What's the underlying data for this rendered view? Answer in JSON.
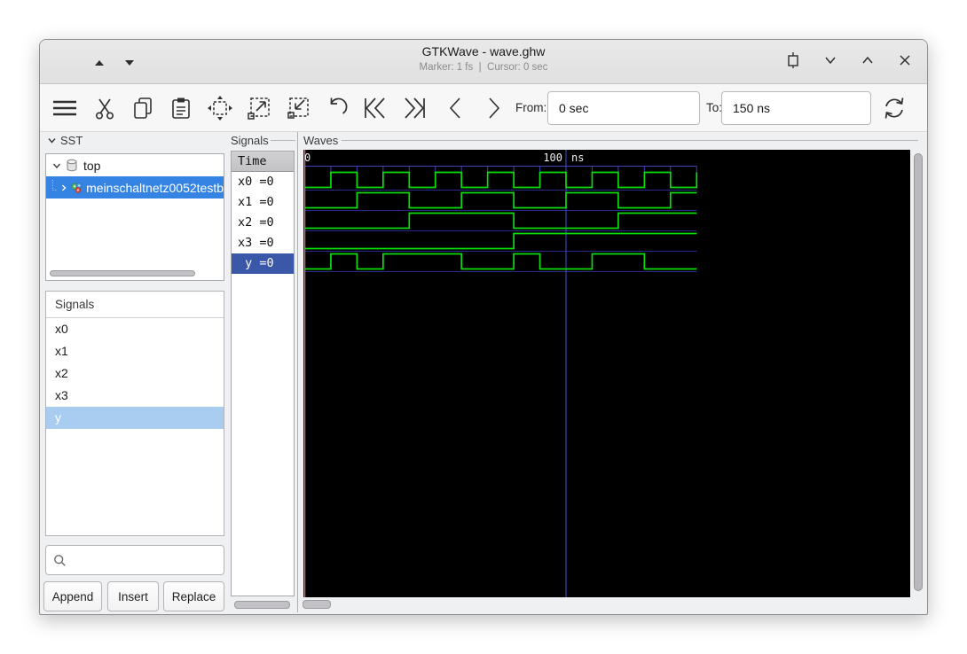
{
  "window": {
    "title": "GTKWave - wave.ghw",
    "marker_status": "Marker: 1 fs",
    "status_separator": "|",
    "cursor_status": "Cursor: 0 sec",
    "control_icons": [
      "frame-icon",
      "chevron-down-icon",
      "chevron-up-icon",
      "close-icon"
    ],
    "titlebar_arrow_icons": [
      "triangle-up-icon",
      "triangle-down-icon"
    ]
  },
  "toolbar": {
    "icons": [
      "menu",
      "cut",
      "copy",
      "paste",
      "zoom-fit",
      "zoom-in",
      "zoom-out",
      "undo",
      "fast-backward",
      "fast-forward",
      "step-left",
      "step-right",
      "reload"
    ],
    "from_label": "From:",
    "from_value": "0 sec",
    "to_label": "To:",
    "to_value": "150 ns"
  },
  "sst": {
    "header": "SST",
    "items": [
      {
        "label": "top",
        "icon": "database-icon",
        "expanded": true,
        "selected": false
      },
      {
        "label": "meinschaltnetz0052testb",
        "icon": "module-icon",
        "expanded": false,
        "selected": true
      }
    ]
  },
  "signal_list": {
    "header": "Signals",
    "items": [
      "x0",
      "x1",
      "x2",
      "x3",
      "y"
    ],
    "selected_index": 4,
    "search_value": "",
    "search_icon": "search-icon",
    "buttons": [
      "Append",
      "Insert",
      "Replace"
    ]
  },
  "values": {
    "header": "Signals",
    "time_header": "Time",
    "rows": [
      "x0 =0",
      "x1 =0",
      "x2 =0",
      "x3 =0",
      " y =0"
    ],
    "selected_index": 4
  },
  "waves": {
    "header": "Waves",
    "ruler_start_label": "0",
    "ruler_major_value": "100",
    "ruler_major_unit": "ns",
    "time_end_ns": 150,
    "tick_interval_ns": 10,
    "major_tick_ns": 100,
    "marker_time_ns": 0,
    "signals": [
      {
        "name": "x0",
        "initial": 0,
        "toggle_times_ns": [
          10,
          20,
          30,
          40,
          50,
          60,
          70,
          80,
          90,
          100,
          110,
          120,
          130,
          140,
          150
        ]
      },
      {
        "name": "x1",
        "initial": 0,
        "toggle_times_ns": [
          20,
          40,
          60,
          80,
          100,
          120,
          140
        ]
      },
      {
        "name": "x2",
        "initial": 0,
        "toggle_times_ns": [
          40,
          80,
          120
        ]
      },
      {
        "name": "x3",
        "initial": 0,
        "toggle_times_ns": [
          80
        ]
      },
      {
        "name": "y",
        "initial": 0,
        "toggle_times_ns": [
          10,
          20,
          30,
          60,
          80,
          90,
          110,
          130
        ]
      }
    ],
    "colors": {
      "background": "#000000",
      "wave": "#0cdc0c",
      "row_grid": "#28288c",
      "ruler": "#4242b2",
      "major_line": "#4a4ace",
      "marker": "#c8707e",
      "ruler_text": "#f0f0f0"
    }
  },
  "accent_colors": {
    "tree_selection": "#3584e4",
    "list_selection": "#a9cdf1",
    "values_selection": "#3a57a8"
  }
}
